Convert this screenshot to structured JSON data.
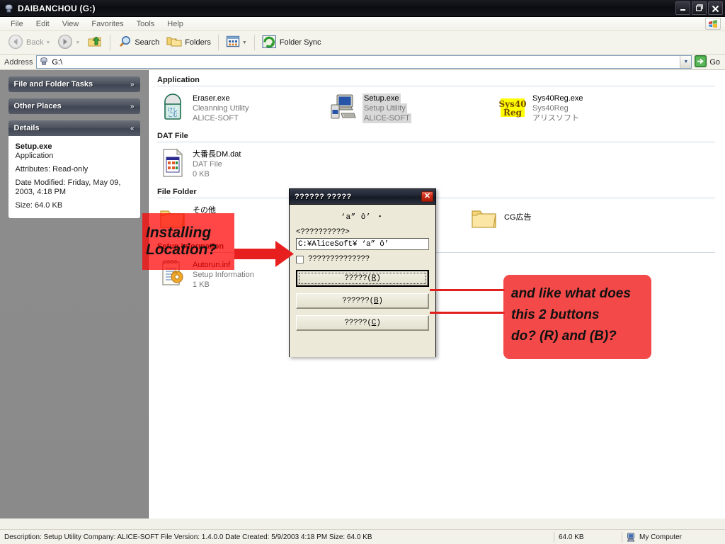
{
  "window": {
    "title": "DAIBANCHOU (G:)",
    "title_icon": "drive-icon",
    "minimize": "_",
    "maximize": "❐",
    "close": "✕"
  },
  "menubar": {
    "items": [
      {
        "label": "File",
        "name": "menu-file"
      },
      {
        "label": "Edit",
        "name": "menu-edit"
      },
      {
        "label": "View",
        "name": "menu-view"
      },
      {
        "label": "Favorites",
        "name": "menu-favorites"
      },
      {
        "label": "Tools",
        "name": "menu-tools"
      },
      {
        "label": "Help",
        "name": "menu-help"
      }
    ],
    "logo_icon": "windows-flag-icon"
  },
  "toolbar": {
    "back": "Back",
    "search": "Search",
    "folders": "Folders",
    "folder_sync": "Folder Sync",
    "icons": {
      "back": "back-arrow-icon",
      "forward": "forward-arrow-icon",
      "up": "up-folder-icon",
      "search": "magnifier-icon",
      "folders": "folders-icon",
      "views": "views-icon",
      "folder_sync": "folder-sync-icon"
    }
  },
  "address": {
    "label": "Address",
    "value": "G:\\",
    "icon": "drive-icon",
    "go_label": "Go",
    "go_icon": "go-arrow-icon",
    "dropdown_icon": "chevron-down-icon"
  },
  "sidebar": {
    "panels": [
      {
        "title": "File and Folder Tasks",
        "name": "panel-file-and-folder-tasks",
        "collapsed": true,
        "chevron": "»"
      },
      {
        "title": "Other Places",
        "name": "panel-other-places",
        "collapsed": true,
        "chevron": "»"
      },
      {
        "title": "Details",
        "name": "panel-details",
        "collapsed": false,
        "chevron": "«"
      }
    ],
    "details": {
      "file_name": "Setup.exe",
      "file_type": "Application",
      "attributes": "Attributes: Read-only",
      "date_modified_line1": "Date Modified: Friday, May 09,",
      "date_modified_line2": "2003, 4:18 PM",
      "size": "Size: 64.0 KB"
    }
  },
  "file_groups": [
    {
      "heading": "Application",
      "name": "group-application",
      "items": [
        {
          "name": "Eraser.exe",
          "sub1": "Cleanning Utility",
          "sub2": "ALICE-SOFT",
          "icon": "eraser-app-icon",
          "selected": false
        },
        {
          "name": "Setup.exe",
          "sub1": "Setup Utility",
          "sub2": "ALICE-SOFT",
          "icon": "setup-app-icon",
          "selected": true
        },
        {
          "name": "Sys40Reg.exe",
          "sub1": "Sys40Reg",
          "sub2": "アリスソフト",
          "icon": "sys40reg-icon",
          "selected": false
        }
      ]
    },
    {
      "heading": "DAT File",
      "name": "group-dat-file",
      "items": [
        {
          "name": "大番長DM.dat",
          "sub1": "DAT File",
          "sub2": "0 KB",
          "icon": "dat-file-icon",
          "selected": false
        }
      ]
    },
    {
      "heading": "File Folder",
      "name": "group-file-folder",
      "items": [
        {
          "name": "その他",
          "sub1": "",
          "sub2": "",
          "icon": "folder-icon",
          "selected": false
        },
        {
          "name": "CG広告",
          "sub1": "",
          "sub2": "",
          "icon": "folder-icon",
          "selected": false
        }
      ]
    },
    {
      "heading": "Setup Information",
      "name": "group-setup-information",
      "items": [
        {
          "name": "Autorun.inf",
          "sub1": "Setup Information",
          "sub2": "1 KB",
          "icon": "inf-file-icon",
          "selected": false
        }
      ]
    }
  ],
  "dialog": {
    "title": "?????? ?????",
    "close_glyph": "✕",
    "heading": "‘a” ô’ ・",
    "sublabel": "<??????????>",
    "path_value": "C:¥AliceSoft¥ ‘a” ô’",
    "checkbox_label": "??????????????",
    "checkbox_checked": false,
    "buttons": [
      {
        "text": "?????(",
        "accel": "R",
        "tail": ")",
        "name": "dialog-button-r",
        "default": true
      },
      {
        "text": "??????(",
        "accel": "B",
        "tail": ")",
        "name": "dialog-button-b",
        "default": false
      },
      {
        "text": "?????(",
        "accel": "C",
        "tail": ")",
        "name": "dialog-button-c",
        "default": false
      }
    ]
  },
  "annotations": {
    "left": {
      "line1": "Installing",
      "line2": "Location?"
    },
    "right": {
      "line1": "and like what does",
      "line2": "this 2 buttons",
      "line3": "do? (R) and (B)?"
    },
    "color": "#f23030"
  },
  "statusbar": {
    "description": "Description: Setup Utility Company: ALICE-SOFT File Version: 1.4.0.0 Date Created: 5/9/2003 4:18 PM Size: 64.0 KB",
    "size": "64.0 KB",
    "location": "My Computer",
    "location_icon": "my-computer-icon"
  }
}
